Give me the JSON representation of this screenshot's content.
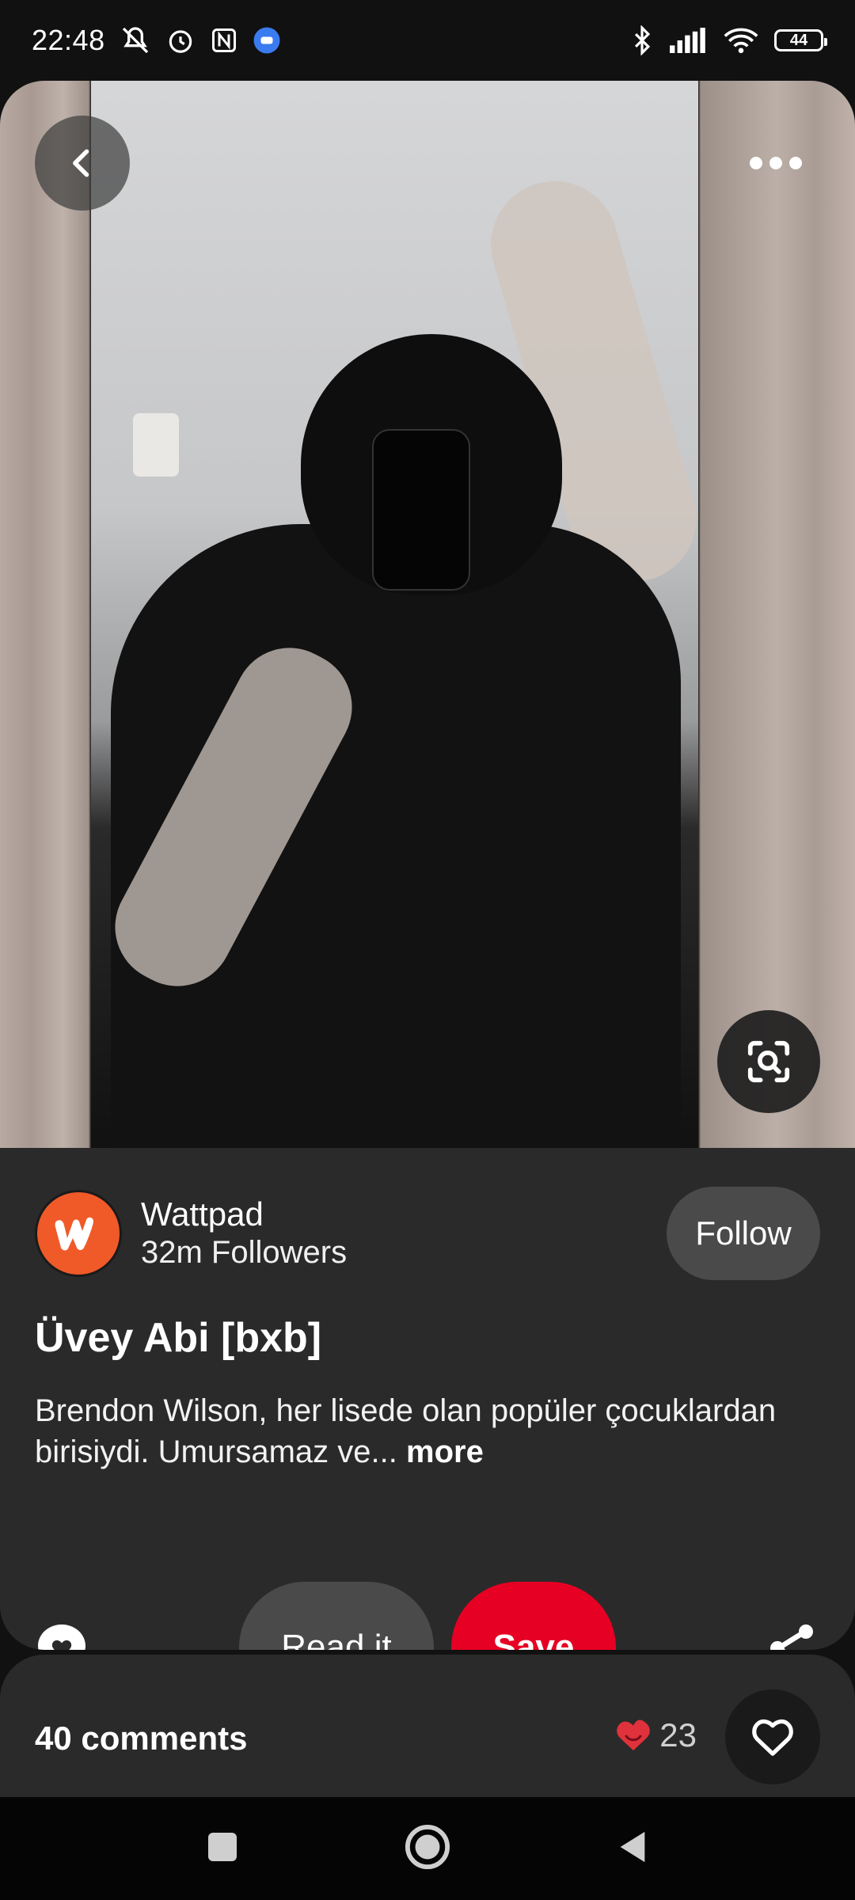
{
  "status_bar": {
    "time": "22:48",
    "battery": "44",
    "icons": [
      "mute-icon",
      "alarm-icon",
      "nfc-icon",
      "app-notification-icon",
      "bluetooth-icon",
      "signal-icon",
      "wifi-icon",
      "battery-icon"
    ]
  },
  "pin": {
    "image_description_icon": "photo",
    "creator": {
      "name": "Wattpad",
      "followers": "32m Followers",
      "follow_label": "Follow",
      "avatar_color": "#f05a28"
    },
    "title": "Üvey Abi [bxb]",
    "description": "Brendon Wilson, her lisede olan popüler çocuklardan birisiydi. Umursamaz ve...",
    "more_label": "more",
    "read_label": "Read it",
    "save_label": "Save",
    "save_color": "#e60023"
  },
  "comments": {
    "label": "40 comments",
    "reaction_count": "23",
    "reaction_color": "#e0323c"
  }
}
